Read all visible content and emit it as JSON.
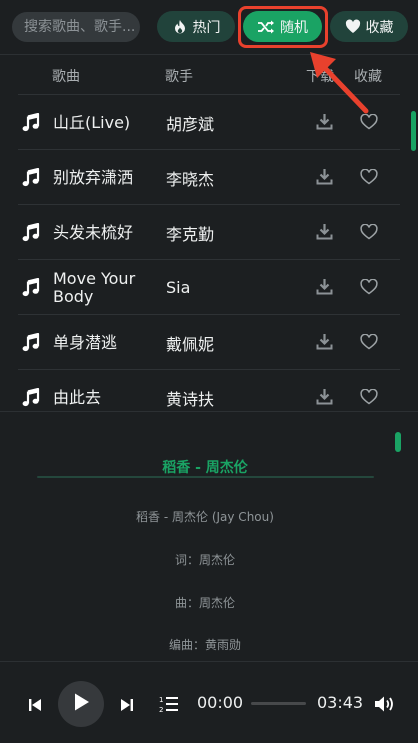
{
  "search": {
    "placeholder": "搜索歌曲、歌手..."
  },
  "tabs": [
    {
      "label": "热门",
      "icon": "flame-icon"
    },
    {
      "label": "随机",
      "icon": "shuffle-icon",
      "active": true
    },
    {
      "label": "收藏",
      "icon": "heart-icon"
    }
  ],
  "list": {
    "headers": {
      "song": "歌曲",
      "artist": "歌手",
      "download": "下载",
      "favorite": "收藏"
    },
    "songs": [
      {
        "title": "山丘(Live)",
        "artist": "胡彦斌"
      },
      {
        "title": "别放弃潇洒",
        "artist": "李晓杰"
      },
      {
        "title": "头发未梳好",
        "artist": "李克勤"
      },
      {
        "title": "Move Your Body",
        "artist": "Sia"
      },
      {
        "title": "单身潜逃",
        "artist": "戴佩妮"
      },
      {
        "title": "由此去",
        "artist": "黄诗扶"
      }
    ]
  },
  "lyrics": {
    "now_playing": "稻香 - 周杰伦",
    "lines": [
      "稻香 - 周杰伦 (Jay Chou)",
      "词：周杰伦",
      "曲：周杰伦",
      "编曲：黄雨勋"
    ]
  },
  "player": {
    "current_time": "00:00",
    "total_time": "03:43",
    "progress": 0
  },
  "colors": {
    "accent": "#1aa364",
    "background": "#1c1f21",
    "tab_background": "#21433b",
    "annotation": "#e8412d"
  }
}
